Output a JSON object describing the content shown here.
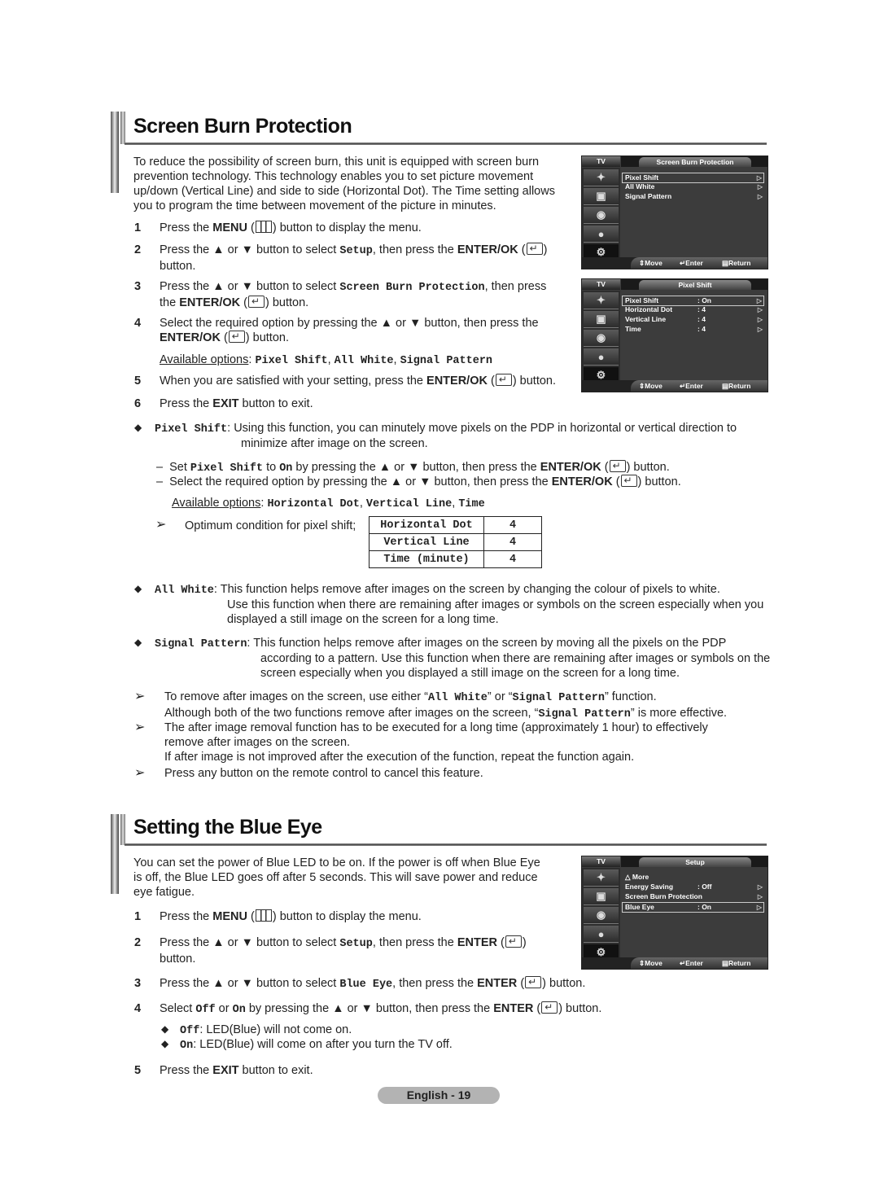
{
  "section1": {
    "title": "Screen Burn Protection",
    "intro": "To reduce the possibility of screen burn, this unit is equipped with screen burn prevention technology. This technology enables you to set picture movement up/down (Vertical Line) and side to side (Horizontal Dot). The Time setting allows you to program the time between movement of the picture in minutes.",
    "intro_lines": [
      "To reduce the possibility of screen burn, this unit is equipped with screen burn",
      "prevention technology. This technology enables you to set picture movement",
      "up/down (Vertical Line) and side to side (Horizontal Dot). The Time setting allows",
      "you to program the time between movement of the picture in minutes."
    ],
    "steps": [
      {
        "num": "1",
        "a": "Press the ",
        "b": "MENU",
        "c": " (",
        "d": ") button to display the menu."
      },
      {
        "num": "2",
        "a": "Press the ▲ or ▼ button to select ",
        "code": "Setup",
        "c": ", then press the ",
        "b": "ENTER/OK",
        "d": " (",
        "e": ")",
        "line2": "button."
      },
      {
        "num": "3",
        "a": "Press the ▲ or ▼ button to select ",
        "code": "Screen Burn Protection",
        "c": ", then press",
        "line2a": "the ",
        "b": "ENTER/OK",
        "d": " (",
        "e": ") button."
      },
      {
        "num": "4",
        "a": "Select the required option by pressing the ▲ or ▼ button, then press the",
        "b": "ENTER/OK",
        "d": " (",
        "e": ") button."
      },
      {
        "num": "5",
        "a": "When you are satisfied with your setting, press the ",
        "b": "ENTER/OK",
        "d": " (",
        "e": ") button."
      },
      {
        "num": "6",
        "a": "Press the ",
        "b": "EXIT",
        "c": " button to exit."
      }
    ],
    "available_label": "Available options",
    "available_options": [
      "Pixel Shift",
      "All White",
      "Signal Pattern"
    ],
    "pixel_shift": {
      "term": "Pixel Shift",
      "desc_lines": [
        "Using this function, you can minutely move pixels on the PDP in horizontal or vertical direction to",
        "minimize after image on the screen."
      ],
      "sub1": {
        "a": "Set ",
        "code1": "Pixel Shift",
        "b": " to ",
        "code2": "On",
        "c": " by pressing the ▲ or ▼ button, then press the ",
        "bold": "ENTER/OK",
        "d": " (",
        "e": ") button."
      },
      "sub2": {
        "a": "Select the required option by pressing the ▲ or ▼ button, then press the ",
        "bold": "ENTER/OK",
        "d": " (",
        "e": ") button."
      },
      "available_label": "Available options",
      "available_options": [
        "Horizontal Dot",
        "Vertical Line",
        "Time"
      ],
      "optimum_label": "Optimum condition for pixel shift;",
      "optimum_table": [
        {
          "name": "Horizontal Dot",
          "value": "4"
        },
        {
          "name": "Vertical Line",
          "value": "4"
        },
        {
          "name": "Time (minute)",
          "value": "4"
        }
      ]
    },
    "all_white": {
      "term": "All White",
      "desc_lines": [
        "This function helps remove after images on the screen by changing the colour of pixels to white.",
        "Use this function when there are remaining after images or symbols on the screen especially when you",
        "displayed a still image on the screen for a long time."
      ]
    },
    "signal_pattern": {
      "term": "Signal Pattern",
      "desc_lines": [
        "This function helps remove after images on the screen by moving all the pixels on the PDP",
        "according to a pattern. Use this function when there are remaining after images or symbols on the",
        "screen especially when you displayed a still image on the screen for a long time."
      ]
    },
    "notes": [
      {
        "l1a": "To remove after images on the screen, use either “",
        "c1": "All White",
        "l1b": "” or “",
        "c2": "Signal Pattern",
        "l1c": "” function.",
        "l2a": "Although both of the two functions remove after images on the screen, “",
        "c3": "Signal Pattern",
        "l2b": "” is more effective."
      },
      {
        "l1": "The after image removal function has to be executed for a long time (approximately 1 hour) to effectively",
        "l2": "remove after images on the screen.",
        "l3": "If after image is not improved after the execution of the function, repeat the function again."
      },
      {
        "l1": "Press any button on the remote control to cancel this feature."
      }
    ],
    "osd1": {
      "tv": "TV",
      "title": "Screen Burn Protection",
      "items": [
        {
          "label": "Pixel Shift",
          "value": "",
          "selected": true
        },
        {
          "label": "All White",
          "value": "",
          "selected": false
        },
        {
          "label": "Signal Pattern",
          "value": "",
          "selected": false
        }
      ],
      "footer": {
        "move": "Move",
        "enter": "Enter",
        "return": "Return"
      }
    },
    "osd2": {
      "tv": "TV",
      "title": "Pixel Shift",
      "items": [
        {
          "label": "Pixel Shift",
          "value": ": On",
          "selected": true
        },
        {
          "label": "Horizontal Dot",
          "value": ": 4",
          "selected": false
        },
        {
          "label": "Vertical Line",
          "value": ": 4",
          "selected": false
        },
        {
          "label": "Time",
          "value": ": 4",
          "selected": false
        }
      ],
      "footer": {
        "move": "Move",
        "enter": "Enter",
        "return": "Return"
      }
    }
  },
  "section2": {
    "title": "Setting the Blue Eye",
    "intro_lines": [
      "You can set the power of Blue LED to be on. If the power is off when Blue Eye",
      "is off, the Blue LED goes off after 5 seconds. This will save power and reduce",
      "eye fatigue."
    ],
    "steps": [
      {
        "num": "1",
        "a": "Press the ",
        "b": "MENU",
        "c": " (",
        "d": ") button to display the menu."
      },
      {
        "num": "2",
        "a": "Press the ▲ or ▼ button to select ",
        "code": "Setup",
        "c": ", then press the ",
        "b": "ENTER",
        "d": " (",
        "e": ")",
        "line2": "button."
      },
      {
        "num": "3",
        "a": "Press the ▲ or ▼ button to select ",
        "code": "Blue Eye",
        "c": ", then press the ",
        "b": "ENTER",
        "d": " (",
        "e": ") button."
      },
      {
        "num": "4",
        "a": "Select ",
        "code1": "Off",
        "m": " or ",
        "code2": "On",
        "c": " by pressing the ▲ or ▼ button, then press the ",
        "b": "ENTER",
        "d": " (",
        "e": ") button."
      },
      {
        "num": "5",
        "a": "Press the ",
        "b": "EXIT",
        "c": " button to exit."
      }
    ],
    "options": [
      {
        "term": "Off",
        "desc": ": LED(Blue) will not come on."
      },
      {
        "term": "On",
        "desc": ": LED(Blue) will come on after you turn the TV off."
      }
    ],
    "osd": {
      "tv": "TV",
      "title": "Setup",
      "more": "More",
      "items": [
        {
          "label": "Energy Saving",
          "value": ": Off",
          "selected": false
        },
        {
          "label": "Screen Burn Protection",
          "value": "",
          "selected": false
        },
        {
          "label": "Blue Eye",
          "value": ": On",
          "selected": true
        }
      ],
      "footer": {
        "move": "Move",
        "enter": "Enter",
        "return": "Return"
      }
    }
  },
  "footer": {
    "page_label": "English - 19"
  },
  "icons": {
    "menu": "menu-icon",
    "enter": "enter-icon",
    "up": "▲",
    "down": "▼",
    "bullet": "◆",
    "note": "➢",
    "arrow_right": "▷",
    "move": "⇕",
    "more": "△"
  }
}
